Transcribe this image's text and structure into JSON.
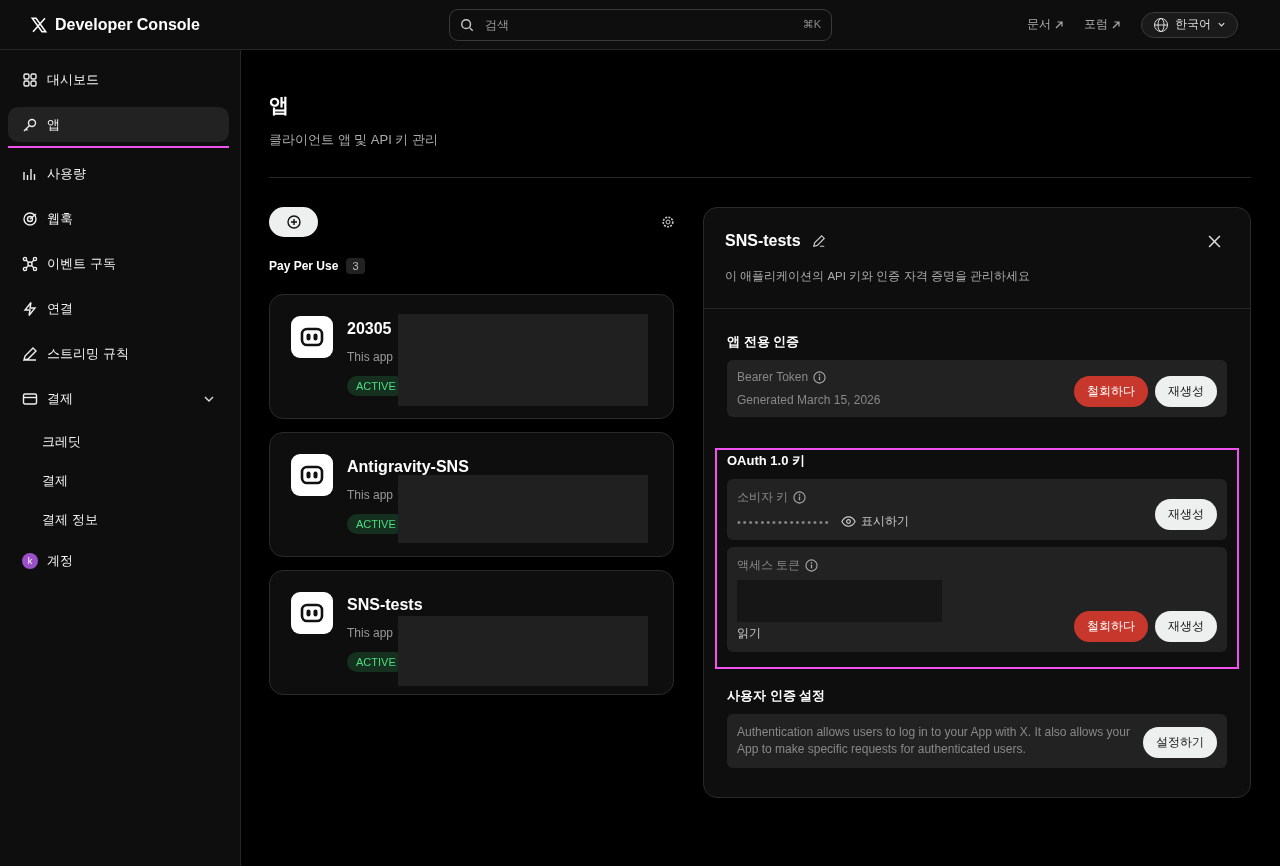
{
  "header": {
    "brand": "Developer Console",
    "search": {
      "placeholder": "검색",
      "shortcut": "⌘K"
    },
    "links": [
      "문서",
      "포럼"
    ],
    "language": "한국어"
  },
  "sidebar": {
    "items": [
      {
        "kind": "item",
        "label": "대시보드",
        "selected": false,
        "highlighted": false
      },
      {
        "kind": "item",
        "label": "앱",
        "selected": true,
        "highlighted": true
      },
      {
        "kind": "item",
        "label": "사용량",
        "selected": false,
        "highlighted": false
      },
      {
        "kind": "item",
        "label": "웹훅",
        "selected": false,
        "highlighted": false
      },
      {
        "kind": "item",
        "label": "이벤트 구독",
        "selected": false,
        "highlighted": false
      },
      {
        "kind": "item",
        "label": "연결",
        "selected": false,
        "highlighted": false
      },
      {
        "kind": "item",
        "label": "스트리밍 규칙",
        "selected": false,
        "highlighted": false
      },
      {
        "kind": "group",
        "label": "결제",
        "selected": false,
        "highlighted": false,
        "expanded": true,
        "children": [
          {
            "label": "크레딧",
            "selected": false
          },
          {
            "label": "결제",
            "selected": false
          },
          {
            "label": "결제 정보",
            "selected": false
          }
        ]
      },
      {
        "kind": "account",
        "label": "계정",
        "selected": false,
        "highlighted": false,
        "avatar": "k",
        "color": "#9b4fc8"
      }
    ]
  },
  "page": {
    "title": "앱",
    "subtitle": "클라이언트 앱 및 API 키 관리"
  },
  "apps": {
    "plan": "Pay Per Use",
    "count": "3",
    "items": [
      {
        "name": "20305",
        "description": "This app",
        "status": "ACTIVE",
        "redacted": true
      },
      {
        "name": "Antigravity-SNS",
        "description": "This app",
        "status": "ACTIVE",
        "redacted": true
      },
      {
        "name": "SNS-tests",
        "description": "This app",
        "status": "ACTIVE",
        "redacted": true
      }
    ]
  },
  "panel": {
    "title": "SNS-tests",
    "description": "이 애플리케이션의 API 키와 인증 자격 증명을 관리하세요",
    "sections": [
      {
        "title": "앱 전용 인증",
        "highlighted": false,
        "rows": [
          {
            "kind": "token",
            "label": "Bearer Token",
            "detail": "Generated March 15, 2026",
            "buttons": [
              {
                "kind": "danger",
                "label": "철회하다"
              },
              {
                "kind": "light",
                "label": "재생성"
              }
            ]
          }
        ]
      },
      {
        "title": "OAuth 1.0 키",
        "highlighted": true,
        "rows": [
          {
            "kind": "secret",
            "label": "소비자 키",
            "masked": "••••••••••••••••",
            "reveal": "표시하기",
            "buttons": [
              {
                "kind": "light",
                "label": "재생성"
              }
            ]
          },
          {
            "kind": "redacted",
            "label": "액세스 토큰",
            "detail": "읽기",
            "buttons": [
              {
                "kind": "danger",
                "label": "철회하다"
              },
              {
                "kind": "light",
                "label": "재생성"
              }
            ]
          }
        ]
      },
      {
        "title": "사용자 인증 설정",
        "highlighted": false,
        "rows": [
          {
            "kind": "text",
            "text": "Authentication allows users to log in to your App with X. It also allows your App to make specific requests for authenticated users.",
            "buttons": [
              {
                "kind": "light",
                "label": "설정하기"
              }
            ]
          }
        ]
      }
    ]
  }
}
